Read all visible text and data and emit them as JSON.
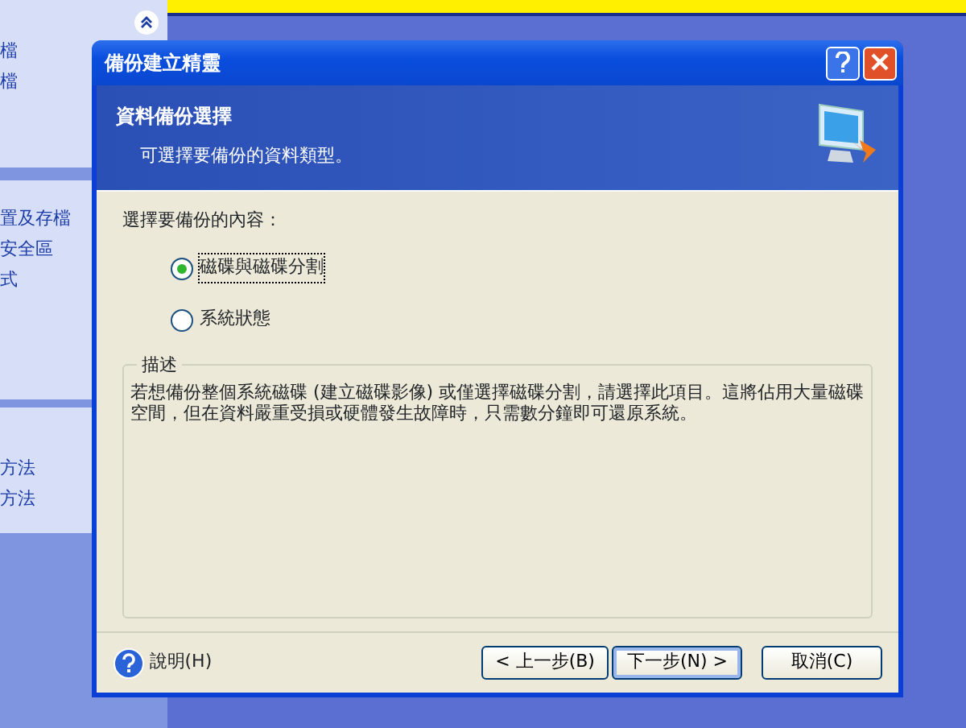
{
  "sidebar": {
    "groups": [
      {
        "items": [
          "檔",
          "檔"
        ]
      },
      {
        "items": [
          "置及存檔",
          "安全區",
          "式"
        ]
      },
      {
        "items": [
          "方法",
          "方法"
        ]
      }
    ]
  },
  "dialog": {
    "title": "備份建立精靈",
    "header": {
      "title": "資料備份選擇",
      "subtitle": "可選擇要備份的資料類型。"
    },
    "prompt": "選擇要備份的內容：",
    "options": [
      {
        "label": "磁碟與磁碟分割",
        "selected": true
      },
      {
        "label": "系統狀態",
        "selected": false
      }
    ],
    "description": {
      "legend": "描述",
      "text": "若想備份整個系統磁碟 (建立磁碟影像) 或僅選擇磁碟分割，請選擇此項目。這將佔用大量磁碟空間，但在資料嚴重受損或硬體發生故障時，只需數分鐘即可還原系統。"
    },
    "help": "說明(H)",
    "buttons": [
      {
        "label": "< 上一步(B)",
        "default": false
      },
      {
        "label": "下一步(N) >",
        "default": true
      },
      {
        "label": "取消(C)",
        "default": false
      }
    ]
  }
}
